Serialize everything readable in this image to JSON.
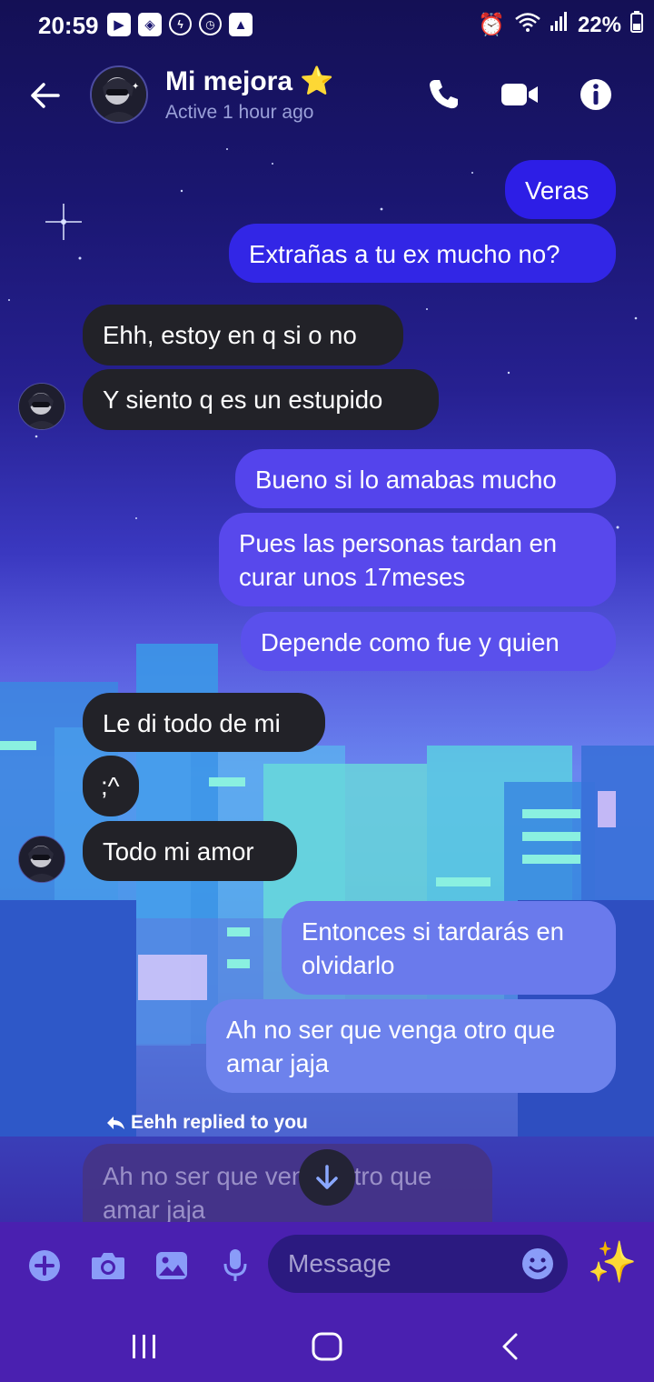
{
  "status_bar": {
    "time": "20:59",
    "battery": "22%"
  },
  "header": {
    "name": "Mi mejora",
    "name_emoji": "⭐",
    "status": "Active 1 hour ago"
  },
  "messages": [
    {
      "side": "out",
      "text": "Veras"
    },
    {
      "side": "out",
      "text": "Extrañas a tu ex mucho no?"
    },
    {
      "side": "in",
      "text": "Ehh, estoy en q si o no"
    },
    {
      "side": "in",
      "text": "Y siento q es un estupido"
    },
    {
      "side": "out",
      "text": "Bueno si lo amabas mucho"
    },
    {
      "side": "out",
      "text": "Pues las personas tardan en curar unos 17meses"
    },
    {
      "side": "out",
      "text": "Depende como fue y quien"
    },
    {
      "side": "in",
      "text": "Le di todo de mi"
    },
    {
      "side": "in",
      "text": ";^"
    },
    {
      "side": "in",
      "text": "Todo mi amor"
    },
    {
      "side": "out",
      "text": "Entonces si tardarás en olvidarlo"
    },
    {
      "side": "out",
      "text": "Ah no ser que venga otro que amar jaja"
    }
  ],
  "reply": {
    "label": "Eehh replied to you",
    "quoted_text": "Ah no ser que venga otro que amar jaja"
  },
  "composer": {
    "placeholder": "Message",
    "effect_emoji": "✨"
  },
  "colors": {
    "incoming_bubble": "#222228",
    "outgoing_top": "#2d1ee6",
    "outgoing_bottom": "#6d82ec",
    "composer_bar": "#4a20b0",
    "accent_icon": "#8a9cf8"
  },
  "icons": [
    "back-arrow-icon",
    "phone-icon",
    "video-camera-icon",
    "info-icon",
    "plus-icon",
    "camera-icon",
    "image-icon",
    "microphone-icon",
    "emoji-icon",
    "sparkles-icon",
    "reply-arrow-icon",
    "arrow-down-icon"
  ]
}
